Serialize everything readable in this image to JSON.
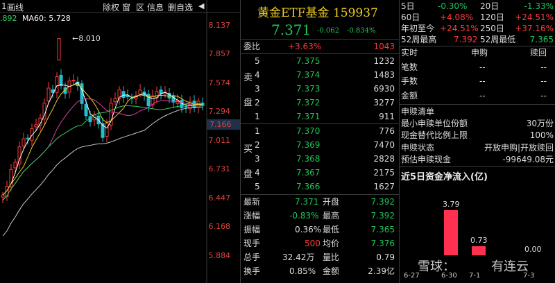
{
  "toolbar": {
    "left_value": "1",
    "mode_label": "画线",
    "ma_prefix": ".892",
    "ma60_label": "MA60: 5.728",
    "buttons": [
      "除权",
      "窗",
      "区",
      "信息",
      "删自选"
    ],
    "close_arrow": "◀"
  },
  "chart": {
    "axis_labels": [
      "8.137",
      "7.857",
      "7.574",
      "7.294",
      "7.166",
      "7.011",
      "6.731",
      "6.447",
      "6.168",
      "5.884"
    ],
    "current_tag": "7.166",
    "peak_label": "8.010",
    "colors": {
      "up": "#ff3b3b",
      "down": "#20c0d0",
      "ma5": "#ffffff",
      "ma10": "#f0d020",
      "ma20": "#e040a0",
      "ma60": "#30d060",
      "ma120": "#c8c8c8"
    }
  },
  "quote": {
    "title": "黄金ETF基金 159937",
    "price": "7.371",
    "change": "-0.062",
    "change_pct": "-0.834%",
    "weibi_label": "委比",
    "weibi_pct": "+3.63%",
    "weibi_val": "1043",
    "sell_label": [
      "卖",
      "盘"
    ],
    "buy_label": [
      "买",
      "盘"
    ],
    "asks": [
      {
        "level": "5",
        "price": "7.375",
        "vol": "1232"
      },
      {
        "level": "4",
        "price": "7.374",
        "vol": "1483"
      },
      {
        "level": "3",
        "price": "7.373",
        "vol": "6930"
      },
      {
        "level": "2",
        "price": "7.372",
        "vol": "3277"
      },
      {
        "level": "1",
        "price": "7.371",
        "vol": "911"
      }
    ],
    "bids": [
      {
        "level": "1",
        "price": "7.370",
        "vol": "776"
      },
      {
        "level": "2",
        "price": "7.369",
        "vol": "7470"
      },
      {
        "level": "3",
        "price": "7.368",
        "vol": "2828"
      },
      {
        "level": "4",
        "price": "7.367",
        "vol": "2175"
      },
      {
        "level": "5",
        "price": "7.366",
        "vol": "1627"
      }
    ],
    "stats": [
      {
        "l1": "最新",
        "v1": "7.371",
        "l2": "开盘",
        "v2": "7.392"
      },
      {
        "l1": "涨幅",
        "v1": "-0.83%",
        "l2": "最高",
        "v2": "7.392"
      },
      {
        "l1": "振幅",
        "v1": "0.36%",
        "l2": "最低",
        "v2": "7.365"
      },
      {
        "l1": "现手",
        "v1": "500",
        "l2": "均价",
        "v2": "7.376"
      },
      {
        "l1": "总手",
        "v1": "32.42万",
        "l2": "量比",
        "v2": "0.79"
      },
      {
        "l1": "换手",
        "v1": "0.85%",
        "l2": "金额",
        "v2": "2.39亿"
      }
    ]
  },
  "perf": [
    {
      "l1": "5日",
      "v1": "-0.30%",
      "l2": "20日",
      "v2": "-1.33%"
    },
    {
      "l1": "60日",
      "v1": "+4.08%",
      "l2": "120日",
      "v2": "+24.51%"
    },
    {
      "l1": "年初至今",
      "v1": "+24.51%",
      "l2": "250日",
      "v2": "+37.16%"
    },
    {
      "l1": "52周最高",
      "v1": "7.392",
      "l2": "52周最低",
      "v2": "7.365"
    }
  ],
  "realtime": {
    "header": [
      "实时",
      "申购",
      "赎回"
    ],
    "rows": [
      {
        "label": "笔数",
        "a": "--",
        "b": "--"
      },
      {
        "label": "手数",
        "a": "--",
        "b": "--"
      },
      {
        "label": "金额",
        "a": "--",
        "b": "--"
      }
    ]
  },
  "redeem": {
    "title": "申赎清单",
    "rows": [
      {
        "label": "最小申赎单位份额",
        "value": "30万份"
      },
      {
        "label": "现金替代比例上限",
        "value": "100%"
      },
      {
        "label": "申赎状态",
        "value": "开放申购|开放赎回"
      },
      {
        "label": "预估申赎现金",
        "value": "-99649.08元"
      }
    ]
  },
  "flow": {
    "title": "近5日资金净流入(亿)",
    "chart_data": {
      "type": "bar",
      "categories": [
        "6-27",
        "6-30",
        "7-1",
        "7-3"
      ],
      "values": [
        null,
        3.79,
        0.73,
        0.0
      ],
      "labels": [
        "",
        "3.79",
        "0.73",
        "0.00"
      ]
    },
    "watermark": [
      "雪球：",
      "有连云"
    ]
  }
}
